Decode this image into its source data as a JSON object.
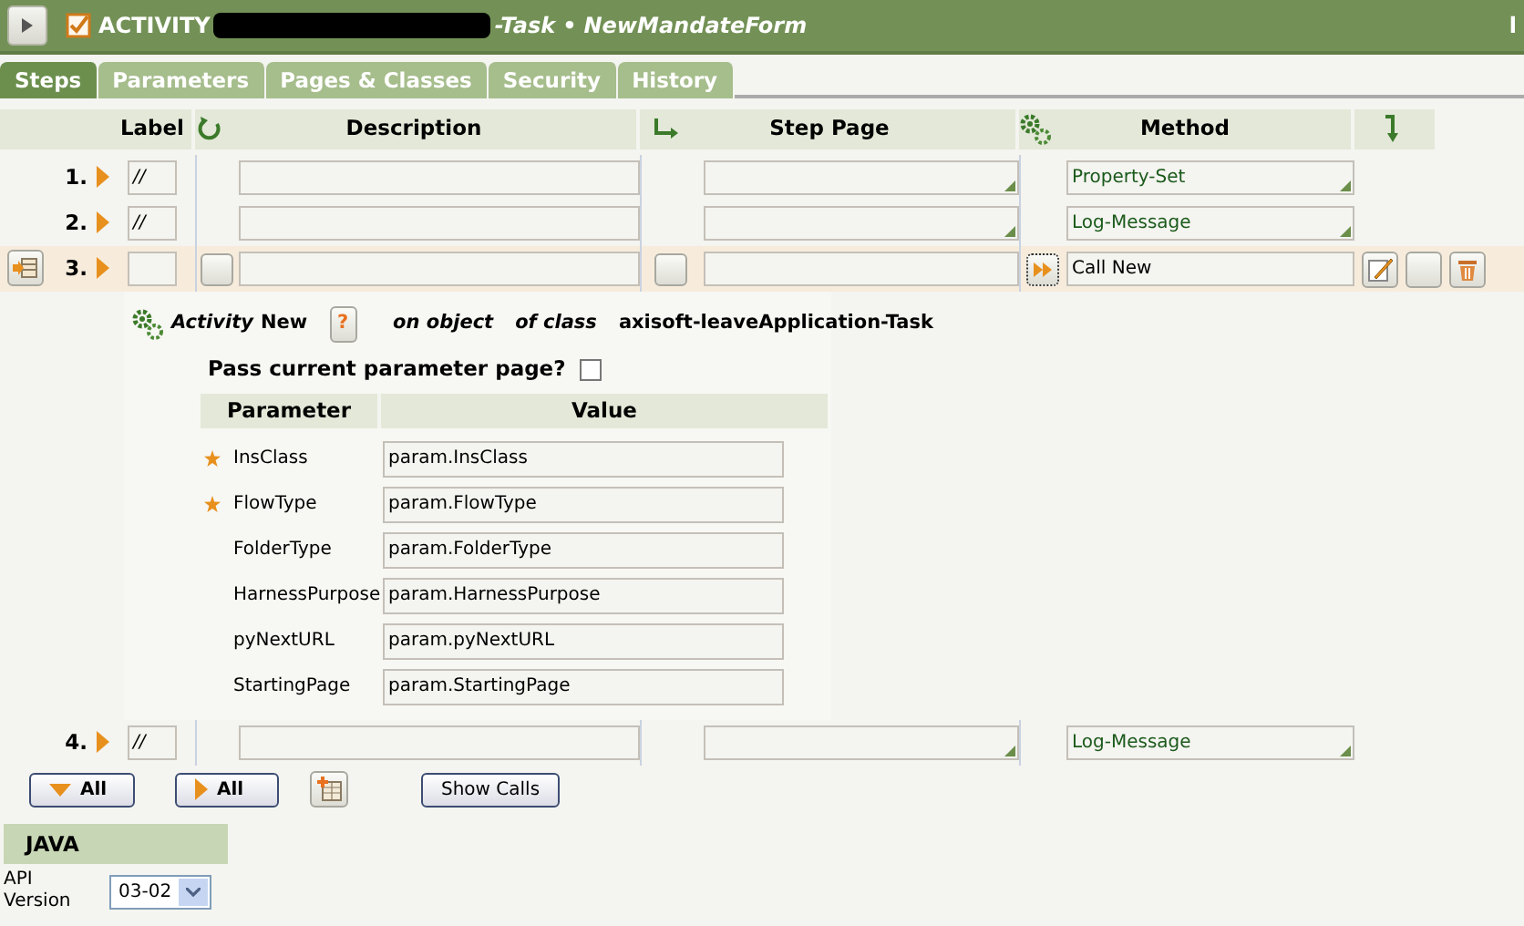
{
  "header": {
    "checked": true,
    "title": "ACTIVITY",
    "title_tail": "-Task",
    "separator": "•",
    "form_name": "NewMandateForm",
    "right_text": "l"
  },
  "tabs": [
    {
      "label": "Steps",
      "selected": true
    },
    {
      "label": "Parameters",
      "selected": false
    },
    {
      "label": "Pages & Classes",
      "selected": false
    },
    {
      "label": "Security",
      "selected": false
    },
    {
      "label": "History",
      "selected": false
    }
  ],
  "steps_table": {
    "columns": [
      "Label",
      "Description",
      "Step Page",
      "Method"
    ],
    "rows": [
      {
        "number": "1.",
        "label": "//",
        "method": "Property-Set",
        "selected": false
      },
      {
        "number": "2.",
        "label": "//",
        "method": "Log-Message",
        "selected": false
      },
      {
        "number": "3.",
        "method": "Call New",
        "selected": true
      },
      {
        "number": "4.",
        "label": "//",
        "method": "Log-Message",
        "selected": false
      }
    ]
  },
  "call_detail": {
    "activity_label": "Activity",
    "activity_name": "New",
    "help": "?",
    "on_object": "on object",
    "of_class": "of class",
    "class_name": "axisoft-leaveApplication-Task",
    "pass_label": "Pass current parameter page?",
    "pass_checked": false,
    "columns": [
      "Parameter",
      "Value"
    ],
    "params": [
      {
        "name": "InsClass",
        "value": "param.InsClass",
        "required": true
      },
      {
        "name": "FlowType",
        "value": "param.FlowType",
        "required": true
      },
      {
        "name": "FolderType",
        "value": "param.FolderType",
        "required": false
      },
      {
        "name": "HarnessPurpose",
        "value": "param.HarnessPurpose",
        "required": false
      },
      {
        "name": "pyNextURL",
        "value": "param.pyNextURL",
        "required": false
      },
      {
        "name": "StartingPage",
        "value": "param.StartingPage",
        "required": false
      }
    ]
  },
  "buttons": [
    {
      "kind": "expand",
      "label": "All"
    },
    {
      "kind": "collapse",
      "label": "All"
    },
    {
      "kind": "add"
    },
    {
      "kind": "text",
      "label": "Show Calls"
    }
  ],
  "java": {
    "title": "JAVA",
    "api_label": "API Version",
    "api_value": "03-02"
  }
}
